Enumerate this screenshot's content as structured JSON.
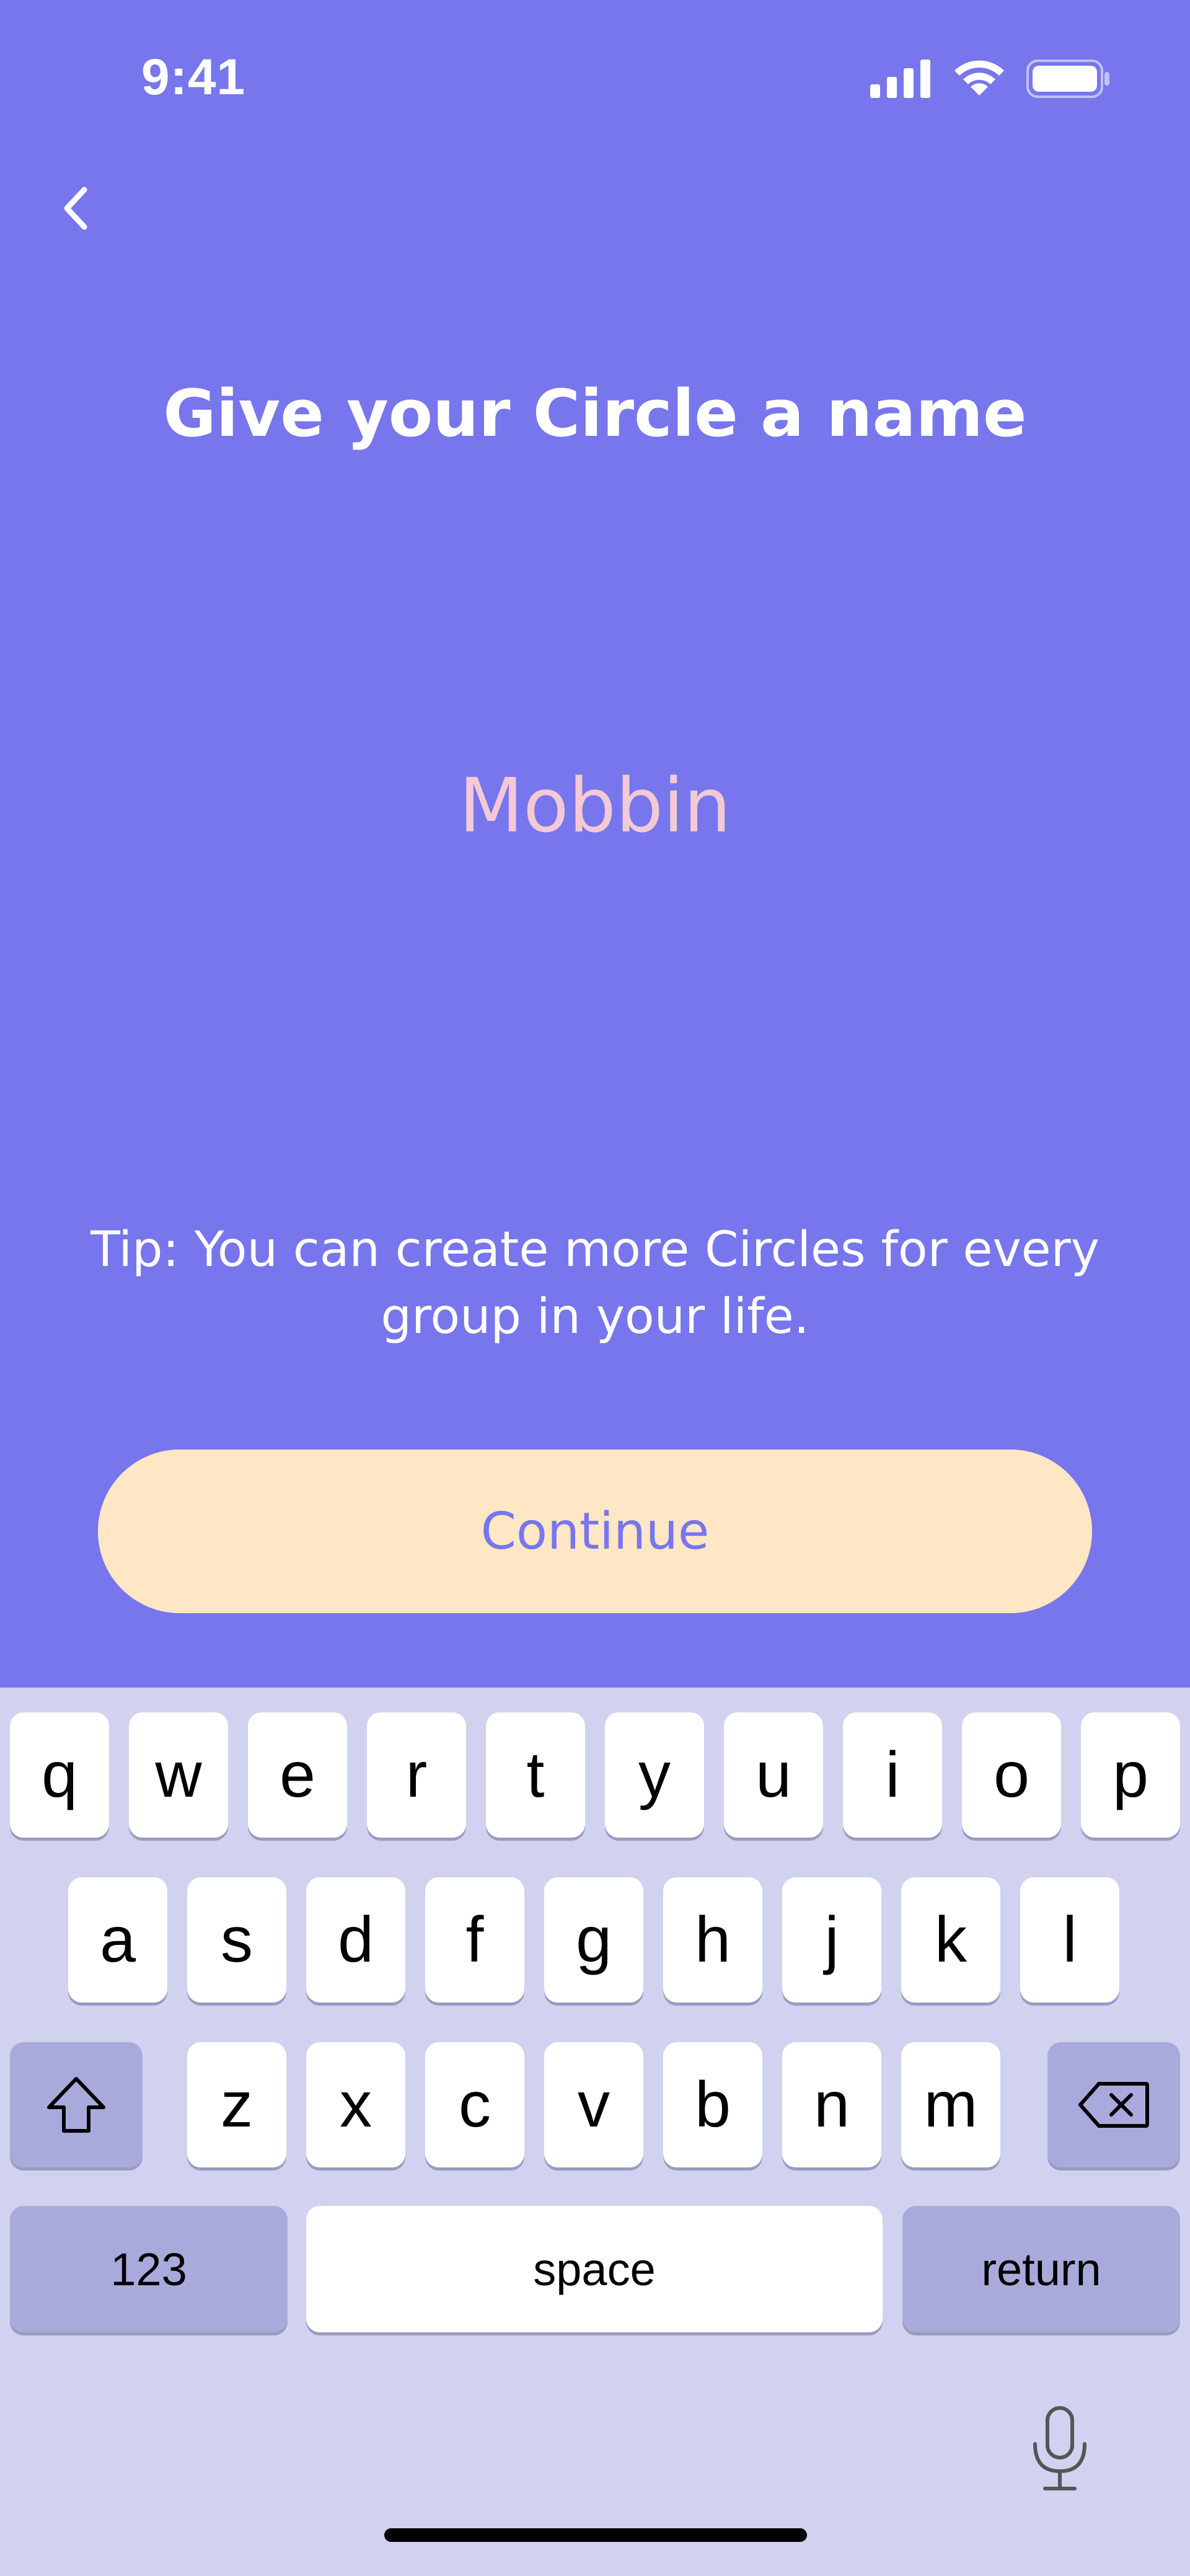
{
  "status_bar": {
    "time": "9:41"
  },
  "screen": {
    "title": "Give your Circle a name",
    "input_value": "Mobbin",
    "tip": "Tip: You can create more Circles for every group in your life.",
    "continue_label": "Continue"
  },
  "colors": {
    "background": "#7776EC",
    "button_bg": "#FFE6C4",
    "input_text": "#F4C9D6",
    "keyboard_bg": "#D1D2EF"
  },
  "keyboard": {
    "row1": [
      "q",
      "w",
      "e",
      "r",
      "t",
      "y",
      "u",
      "i",
      "o",
      "p"
    ],
    "row2": [
      "a",
      "s",
      "d",
      "f",
      "g",
      "h",
      "j",
      "k",
      "l"
    ],
    "row3": [
      "z",
      "x",
      "c",
      "v",
      "b",
      "n",
      "m"
    ],
    "numbers_label": "123",
    "space_label": "space",
    "return_label": "return"
  }
}
